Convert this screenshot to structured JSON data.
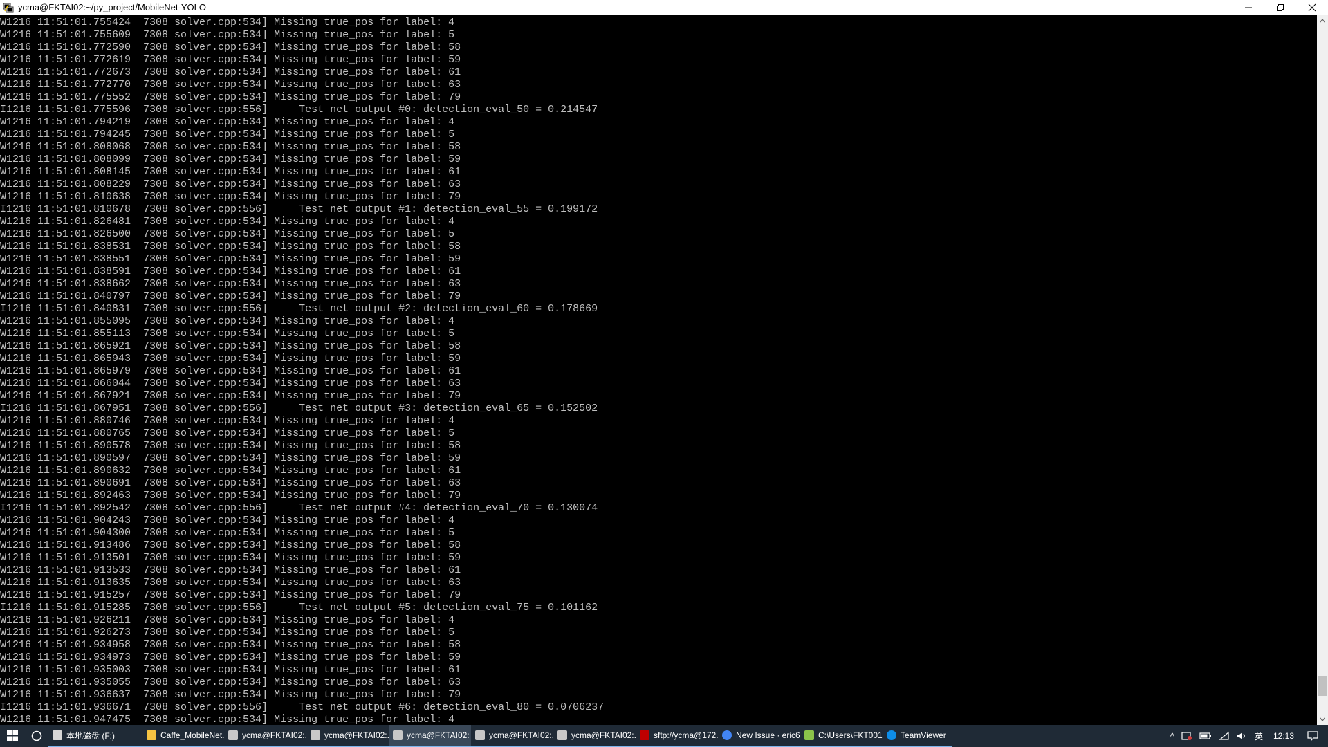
{
  "window": {
    "title": "ycma@FKTAI02:~/py_project/MobileNet-YOLO",
    "controls": {
      "minimize": "–",
      "maximize": "❐",
      "close": "✕"
    }
  },
  "terminal": {
    "lines": [
      "W1216 11:51:01.755424  7308 solver.cpp:534] Missing true_pos for label: 4",
      "W1216 11:51:01.755609  7308 solver.cpp:534] Missing true_pos for label: 5",
      "W1216 11:51:01.772590  7308 solver.cpp:534] Missing true_pos for label: 58",
      "W1216 11:51:01.772619  7308 solver.cpp:534] Missing true_pos for label: 59",
      "W1216 11:51:01.772673  7308 solver.cpp:534] Missing true_pos for label: 61",
      "W1216 11:51:01.772770  7308 solver.cpp:534] Missing true_pos for label: 63",
      "W1216 11:51:01.775552  7308 solver.cpp:534] Missing true_pos for label: 79",
      "I1216 11:51:01.775596  7308 solver.cpp:556]     Test net output #0: detection_eval_50 = 0.214547",
      "W1216 11:51:01.794219  7308 solver.cpp:534] Missing true_pos for label: 4",
      "W1216 11:51:01.794245  7308 solver.cpp:534] Missing true_pos for label: 5",
      "W1216 11:51:01.808068  7308 solver.cpp:534] Missing true_pos for label: 58",
      "W1216 11:51:01.808099  7308 solver.cpp:534] Missing true_pos for label: 59",
      "W1216 11:51:01.808145  7308 solver.cpp:534] Missing true_pos for label: 61",
      "W1216 11:51:01.808229  7308 solver.cpp:534] Missing true_pos for label: 63",
      "W1216 11:51:01.810638  7308 solver.cpp:534] Missing true_pos for label: 79",
      "I1216 11:51:01.810678  7308 solver.cpp:556]     Test net output #1: detection_eval_55 = 0.199172",
      "W1216 11:51:01.826481  7308 solver.cpp:534] Missing true_pos for label: 4",
      "W1216 11:51:01.826500  7308 solver.cpp:534] Missing true_pos for label: 5",
      "W1216 11:51:01.838531  7308 solver.cpp:534] Missing true_pos for label: 58",
      "W1216 11:51:01.838551  7308 solver.cpp:534] Missing true_pos for label: 59",
      "W1216 11:51:01.838591  7308 solver.cpp:534] Missing true_pos for label: 61",
      "W1216 11:51:01.838662  7308 solver.cpp:534] Missing true_pos for label: 63",
      "W1216 11:51:01.840797  7308 solver.cpp:534] Missing true_pos for label: 79",
      "I1216 11:51:01.840831  7308 solver.cpp:556]     Test net output #2: detection_eval_60 = 0.178669",
      "W1216 11:51:01.855095  7308 solver.cpp:534] Missing true_pos for label: 4",
      "W1216 11:51:01.855113  7308 solver.cpp:534] Missing true_pos for label: 5",
      "W1216 11:51:01.865921  7308 solver.cpp:534] Missing true_pos for label: 58",
      "W1216 11:51:01.865943  7308 solver.cpp:534] Missing true_pos for label: 59",
      "W1216 11:51:01.865979  7308 solver.cpp:534] Missing true_pos for label: 61",
      "W1216 11:51:01.866044  7308 solver.cpp:534] Missing true_pos for label: 63",
      "W1216 11:51:01.867921  7308 solver.cpp:534] Missing true_pos for label: 79",
      "I1216 11:51:01.867951  7308 solver.cpp:556]     Test net output #3: detection_eval_65 = 0.152502",
      "W1216 11:51:01.880746  7308 solver.cpp:534] Missing true_pos for label: 4",
      "W1216 11:51:01.880765  7308 solver.cpp:534] Missing true_pos for label: 5",
      "W1216 11:51:01.890578  7308 solver.cpp:534] Missing true_pos for label: 58",
      "W1216 11:51:01.890597  7308 solver.cpp:534] Missing true_pos for label: 59",
      "W1216 11:51:01.890632  7308 solver.cpp:534] Missing true_pos for label: 61",
      "W1216 11:51:01.890691  7308 solver.cpp:534] Missing true_pos for label: 63",
      "W1216 11:51:01.892463  7308 solver.cpp:534] Missing true_pos for label: 79",
      "I1216 11:51:01.892542  7308 solver.cpp:556]     Test net output #4: detection_eval_70 = 0.130074",
      "W1216 11:51:01.904243  7308 solver.cpp:534] Missing true_pos for label: 4",
      "W1216 11:51:01.904300  7308 solver.cpp:534] Missing true_pos for label: 5",
      "W1216 11:51:01.913486  7308 solver.cpp:534] Missing true_pos for label: 58",
      "W1216 11:51:01.913501  7308 solver.cpp:534] Missing true_pos for label: 59",
      "W1216 11:51:01.913533  7308 solver.cpp:534] Missing true_pos for label: 61",
      "W1216 11:51:01.913635  7308 solver.cpp:534] Missing true_pos for label: 63",
      "W1216 11:51:01.915257  7308 solver.cpp:534] Missing true_pos for label: 79",
      "I1216 11:51:01.915285  7308 solver.cpp:556]     Test net output #5: detection_eval_75 = 0.101162",
      "W1216 11:51:01.926211  7308 solver.cpp:534] Missing true_pos for label: 4",
      "W1216 11:51:01.926273  7308 solver.cpp:534] Missing true_pos for label: 5",
      "W1216 11:51:01.934958  7308 solver.cpp:534] Missing true_pos for label: 58",
      "W1216 11:51:01.934973  7308 solver.cpp:534] Missing true_pos for label: 59",
      "W1216 11:51:01.935003  7308 solver.cpp:534] Missing true_pos for label: 61",
      "W1216 11:51:01.935055  7308 solver.cpp:534] Missing true_pos for label: 63",
      "W1216 11:51:01.936637  7308 solver.cpp:534] Missing true_pos for label: 79",
      "I1216 11:51:01.936671  7308 solver.cpp:556]     Test net output #6: detection_eval_80 = 0.0706237",
      "W1216 11:51:01.947475  7308 solver.cpp:534] Missing true_pos for label: 4"
    ]
  },
  "taskbar": {
    "items": [
      {
        "label": "本地磁盘 (F:)",
        "icon": "drive-icon",
        "color": "#d6d6d6",
        "state": "open"
      },
      {
        "label": "Caffe_MobileNet...",
        "icon": "folder-icon",
        "color": "#f6c342",
        "state": "open"
      },
      {
        "label": "ycma@FKTAI02:...",
        "icon": "putty-icon",
        "color": "#c8c8c8",
        "state": "open"
      },
      {
        "label": "ycma@FKTAI02:...",
        "icon": "putty-icon",
        "color": "#c8c8c8",
        "state": "open"
      },
      {
        "label": "ycma@FKTAI02:~...",
        "icon": "putty-icon",
        "color": "#c8c8c8",
        "state": "active"
      },
      {
        "label": "ycma@FKTAI02:...",
        "icon": "putty-icon",
        "color": "#c8c8c8",
        "state": "open"
      },
      {
        "label": "ycma@FKTAI02:...",
        "icon": "putty-icon",
        "color": "#c8c8c8",
        "state": "open"
      },
      {
        "label": "sftp://ycma@172...",
        "icon": "filezilla-icon",
        "color": "#bf0000",
        "state": "open"
      },
      {
        "label": "New Issue · eric6...",
        "icon": "chrome-icon",
        "color": "#4285f4",
        "state": "open"
      },
      {
        "label": "C:\\Users\\FKT001...",
        "icon": "notepad-icon",
        "color": "#8bc34a",
        "state": "open"
      },
      {
        "label": "TeamViewer",
        "icon": "teamviewer-icon",
        "color": "#0e8ee9",
        "state": "open"
      }
    ],
    "tray": {
      "show_hidden": "^",
      "ime": "英",
      "clock": "12:13"
    }
  }
}
